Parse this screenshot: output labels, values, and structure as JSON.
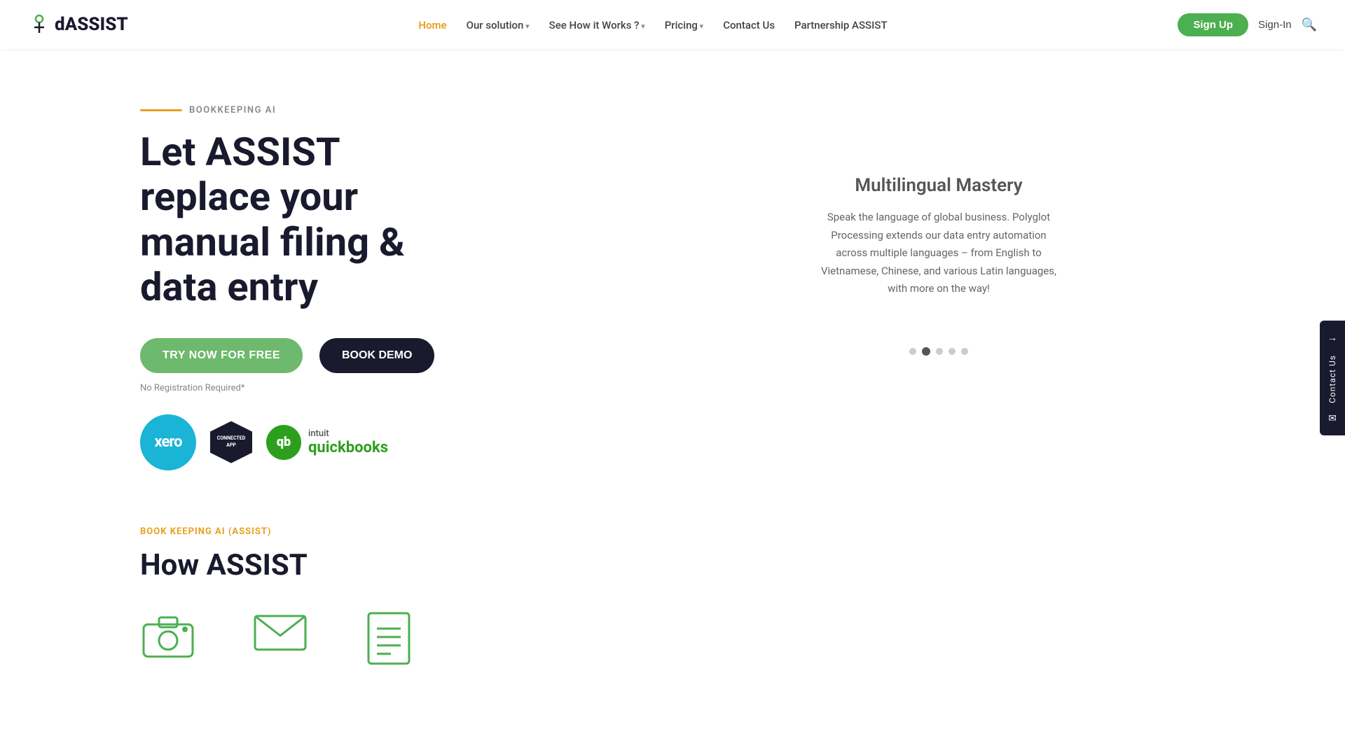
{
  "logo": {
    "text_d": "d",
    "text_assist": "ASSIST"
  },
  "navbar": {
    "home_label": "Home",
    "solution_label": "Our solution",
    "how_works_label": "See How it Works ?",
    "pricing_label": "Pricing",
    "contact_label": "Contact Us",
    "partnership_label": "Partnership ASSIST",
    "signup_label": "Sign Up",
    "signin_label": "Sign-In"
  },
  "hero": {
    "tag": "BOOKKEEPING AI",
    "title_line1": "Let ASSIST",
    "title_line2": "replace your",
    "title_line3": "manual filing &",
    "title_line4": "data entry",
    "try_btn": "TRY NOW FOR FREE",
    "demo_btn": "BOOK DEMO",
    "no_reg": "No Registration Required*"
  },
  "carousel": {
    "current_title": "Multilingual Mastery",
    "current_desc": "Speak the language of global business. Polyglot Processing extends our data entry automation across multiple languages – from English to Vietnamese, Chinese, and various Latin languages, with more on the way!",
    "dots": [
      {
        "active": false
      },
      {
        "active": true
      },
      {
        "active": false
      },
      {
        "active": false
      },
      {
        "active": false
      }
    ]
  },
  "floating_contact": {
    "arrow": "→",
    "label": "Contact Us",
    "mail_icon": "✉"
  },
  "bottom": {
    "tag": "BOOK KEEPING AI (ASSIST)",
    "title_line1": "How ASSIST"
  }
}
